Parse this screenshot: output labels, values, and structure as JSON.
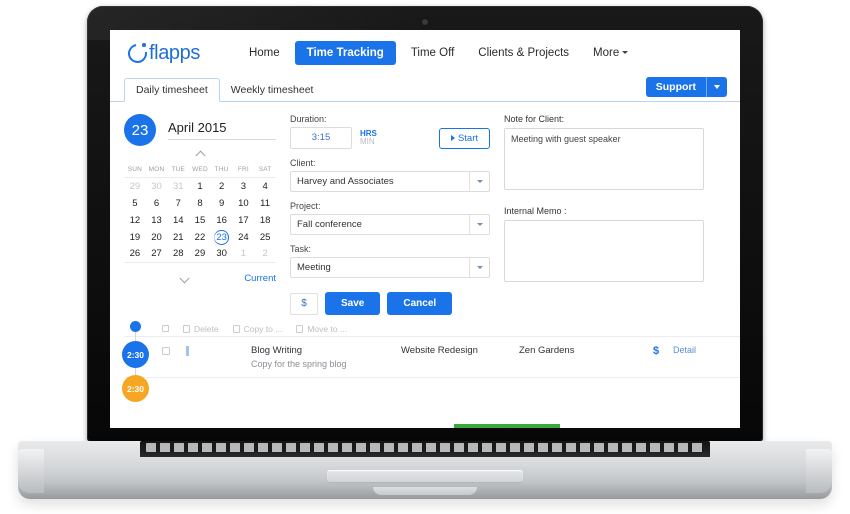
{
  "brand": {
    "name": "flapps",
    "logo_icon": "circle-arc-logo-icon",
    "color": "#1f6fd6"
  },
  "accent": {
    "primary": "#1a73e8",
    "amber": "#f5a623",
    "green": "#3aa83a"
  },
  "top_nav": {
    "items": [
      {
        "label": "Home",
        "active": false
      },
      {
        "label": "Time Tracking",
        "active": true
      },
      {
        "label": "Time Off",
        "active": false
      },
      {
        "label": "Clients & Projects",
        "active": false
      },
      {
        "label": "More",
        "active": false,
        "has_caret": true
      }
    ]
  },
  "tabs": [
    {
      "label": "Daily timesheet",
      "active": true
    },
    {
      "label": "Weekly timesheet",
      "active": false
    }
  ],
  "support": {
    "label": "Support",
    "caret_icon": "caret-down-icon"
  },
  "calendar": {
    "day_number": "23",
    "month_year": "April 2015",
    "prev_icon": "chevron-up-icon",
    "next_icon": "chevron-down-icon",
    "current_label": "Current",
    "weekday_headers": [
      "SUN",
      "MON",
      "TUE",
      "WED",
      "THU",
      "FRI",
      "SAT"
    ],
    "weeks": [
      [
        {
          "d": "29",
          "muted": true
        },
        {
          "d": "30",
          "muted": true
        },
        {
          "d": "31",
          "muted": true
        },
        {
          "d": "1"
        },
        {
          "d": "2"
        },
        {
          "d": "3"
        },
        {
          "d": "4"
        }
      ],
      [
        {
          "d": "5"
        },
        {
          "d": "6"
        },
        {
          "d": "7"
        },
        {
          "d": "8"
        },
        {
          "d": "9"
        },
        {
          "d": "10"
        },
        {
          "d": "11"
        }
      ],
      [
        {
          "d": "12"
        },
        {
          "d": "13"
        },
        {
          "d": "14"
        },
        {
          "d": "15"
        },
        {
          "d": "16"
        },
        {
          "d": "17"
        },
        {
          "d": "18"
        }
      ],
      [
        {
          "d": "19"
        },
        {
          "d": "20"
        },
        {
          "d": "21"
        },
        {
          "d": "22"
        },
        {
          "d": "23",
          "selected": true
        },
        {
          "d": "24"
        },
        {
          "d": "25"
        }
      ],
      [
        {
          "d": "26"
        },
        {
          "d": "27"
        },
        {
          "d": "28"
        },
        {
          "d": "29"
        },
        {
          "d": "30"
        },
        {
          "d": "1",
          "muted": true
        },
        {
          "d": "2",
          "muted": true
        }
      ]
    ]
  },
  "form": {
    "duration_label": "Duration:",
    "duration_value": "3:15",
    "unit_hrs": "HRS",
    "unit_min": "MIN",
    "start_label": "Start",
    "start_icon": "play-icon",
    "client_label": "Client:",
    "client_value": "Harvey and Associates",
    "project_label": "Project:",
    "project_value": "Fall conference",
    "task_label": "Task:",
    "task_value": "Meeting",
    "dropdown_icon": "caret-down-icon"
  },
  "actions": {
    "billable_label": "$",
    "save_label": "Save",
    "cancel_label": "Cancel"
  },
  "notes": {
    "client_note_label": "Note for Client:",
    "client_note_value": "Meeting with guest speaker",
    "internal_memo_label": "Internal Memo :",
    "internal_memo_value": ""
  },
  "bulk_bar": {
    "delete_label": "Delete",
    "delete_icon": "trash-icon",
    "copy_label": "Copy to ...",
    "copy_icon": "copy-icon",
    "move_label": "Move to ...",
    "move_icon": "move-icon"
  },
  "timeline": {
    "blue_node_time": "2:30",
    "amber_node_time": "2:30"
  },
  "entry": {
    "task_title": "Blog Writing",
    "task_desc": "Copy for the spring blog",
    "project": "Website Redesign",
    "client": "Zen Gardens",
    "billable_icon": "dollar-icon",
    "billable_label": "$",
    "detail_label": "Detail"
  }
}
